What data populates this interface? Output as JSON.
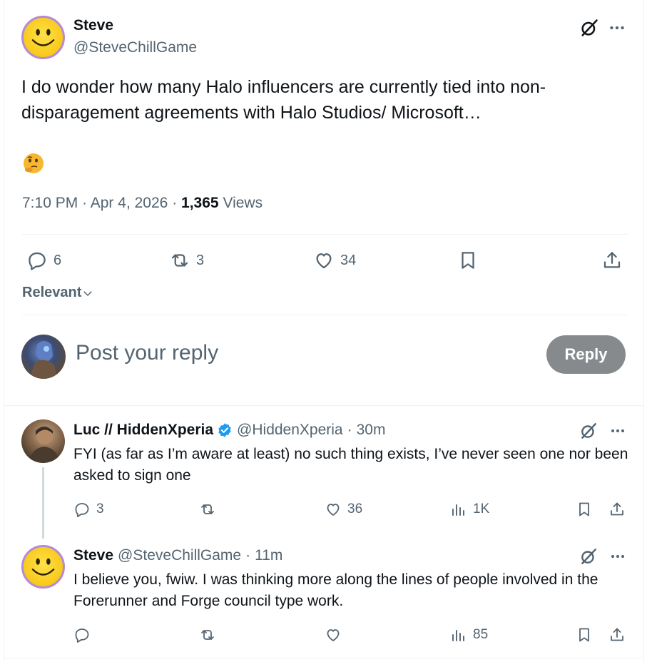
{
  "tweet": {
    "author_name": "Steve",
    "author_handle": "@SteveChillGame",
    "text": "I do wonder how many Halo influencers are currently tied into non-disparagement agreements with Halo Studios/ Microsoft…",
    "emoji": "🤔",
    "time": "7:10 PM",
    "date": "Apr 4, 2026",
    "views_count": "1,365",
    "views_label": "Views",
    "replies": "6",
    "reposts": "3",
    "likes": "34"
  },
  "sort": {
    "label": "Relevant"
  },
  "composer": {
    "placeholder": "Post your reply",
    "button_label": "Reply"
  },
  "replies": [
    {
      "name": "Luc // HiddenXperia",
      "handle": "@HiddenXperia",
      "time": "30m",
      "verified": true,
      "text": "FYI (as far as I’m aware at least) no such thing exists, I’ve never seen one nor been asked to sign one",
      "replies": "3",
      "reposts": "",
      "likes": "36",
      "views": "1K"
    },
    {
      "name": "Steve",
      "handle": "@SteveChillGame",
      "time": "11m",
      "verified": false,
      "text": "I believe you, fwiw. I was thinking more along the lines of people involved in the Forerunner and Forge council type work.",
      "replies": "",
      "reposts": "",
      "likes": "",
      "views": "85"
    }
  ],
  "separator": "·",
  "colors": {
    "text_primary": "#0f1419",
    "text_secondary": "#536471",
    "verified_blue": "#1d9bf0",
    "reply_button_bg": "#878a8c",
    "divider": "#eff3f4"
  },
  "icons": [
    "grok-icon",
    "more-icon",
    "reply-icon",
    "repost-icon",
    "like-icon",
    "bookmark-icon",
    "share-icon",
    "views-icon",
    "verified-icon",
    "chevron-down-icon"
  ]
}
